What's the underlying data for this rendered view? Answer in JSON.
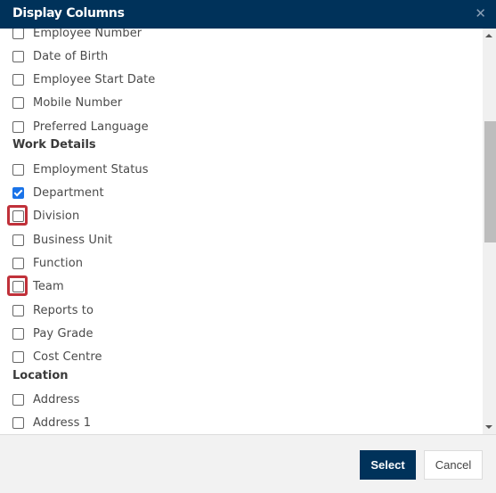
{
  "dialog": {
    "title": "Display Columns",
    "close_icon": "close-icon"
  },
  "list": {
    "personal": [
      {
        "label": "Employee Number",
        "checked": false
      },
      {
        "label": "Date of Birth",
        "checked": false
      },
      {
        "label": "Employee Start Date",
        "checked": false
      },
      {
        "label": "Mobile Number",
        "checked": false
      },
      {
        "label": "Preferred Language",
        "checked": false
      }
    ],
    "work_heading": "Work Details",
    "work": [
      {
        "label": "Employment Status",
        "checked": false
      },
      {
        "label": "Department",
        "checked": true
      },
      {
        "label": "Division",
        "checked": false,
        "highlighted": true
      },
      {
        "label": "Business Unit",
        "checked": false
      },
      {
        "label": "Function",
        "checked": false
      },
      {
        "label": "Team",
        "checked": false,
        "highlighted": true
      },
      {
        "label": "Reports to",
        "checked": false
      },
      {
        "label": "Pay Grade",
        "checked": false
      },
      {
        "label": "Cost Centre",
        "checked": false
      }
    ],
    "location_heading": "Location",
    "location": [
      {
        "label": "Address",
        "checked": false
      },
      {
        "label": "Address 1",
        "checked": false
      }
    ]
  },
  "footer": {
    "select_label": "Select",
    "cancel_label": "Cancel"
  },
  "colors": {
    "header_bg": "#00325a",
    "primary_button": "#00325a",
    "checkbox_checked": "#1a73e8",
    "highlight": "#c0313a"
  }
}
